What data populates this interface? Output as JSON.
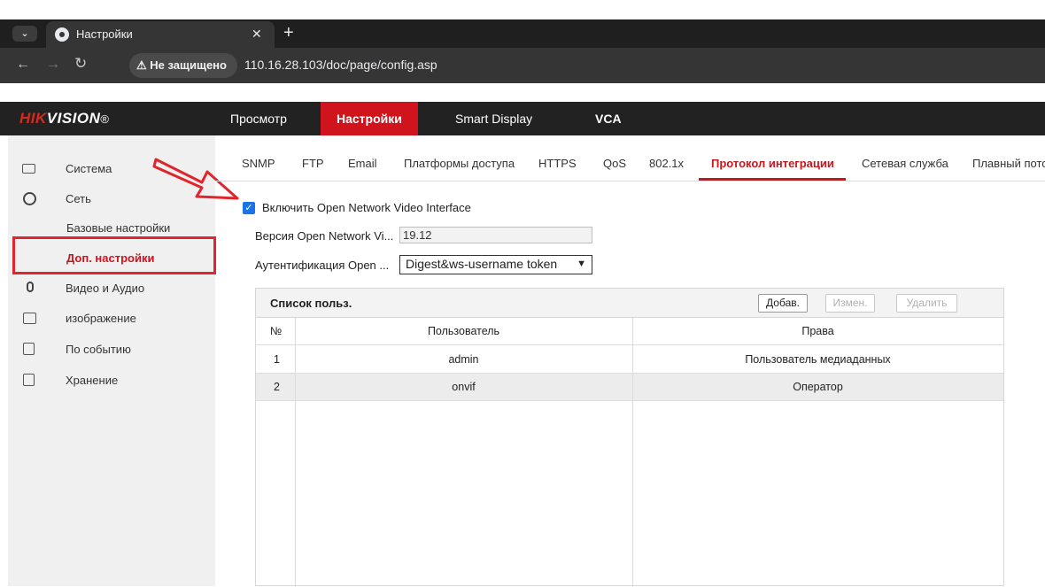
{
  "browser": {
    "tab_title": "Настройки",
    "security_label": "⚠ Не защищено",
    "url": "110.16.28.103/doc/page/config.asp"
  },
  "app": {
    "logo_main": "HIK",
    "logo_rest": "VISION",
    "logo_mark": "®",
    "top_nav": [
      "Просмотр",
      "Настройки",
      "Smart Display",
      "VCA"
    ],
    "top_nav_active": "Настройки"
  },
  "sidebar": {
    "items": [
      {
        "label": "Система",
        "icon": "monitor-icon"
      },
      {
        "label": "Сеть",
        "icon": "globe-icon"
      },
      {
        "label": "Видео и Аудио",
        "icon": "microphone-icon"
      },
      {
        "label": "изображение",
        "icon": "image-icon"
      },
      {
        "label": "По событию",
        "icon": "calendar-icon"
      },
      {
        "label": "Хранение",
        "icon": "save-icon"
      }
    ],
    "subitems": [
      "Базовые настройки",
      "Доп. настройки"
    ],
    "selected_subitem": "Доп. настройки"
  },
  "tabs": [
    "SNMP",
    "FTP",
    "Email",
    "Платформы доступа",
    "HTTPS",
    "QoS",
    "802.1x",
    "Протокол интеграции",
    "Сетевая служба",
    "Плавный пото"
  ],
  "active_tab": "Протокол интеграции",
  "form": {
    "enable_label": "Включить Open Network Video Interface",
    "enable_checked": true,
    "version_label": "Версия Open Network Vi...",
    "version_value": "19.12",
    "auth_label": "Аутентификация Open ...",
    "auth_value": "Digest&ws-username token"
  },
  "user_list": {
    "title": "Список польз.",
    "buttons": {
      "add": "Добав.",
      "edit": "Измен.",
      "delete": "Удалить"
    },
    "columns": [
      "№",
      "Пользователь",
      "Права"
    ],
    "rows": [
      {
        "no": "1",
        "user": "admin",
        "rights": "Пользователь медиаданных"
      },
      {
        "no": "2",
        "user": "onvif",
        "rights": "Оператор"
      }
    ]
  },
  "colors": {
    "accent_red": "#d0131d",
    "checkbox_blue": "#1a73e8",
    "highlight_box": "#e0262d"
  }
}
